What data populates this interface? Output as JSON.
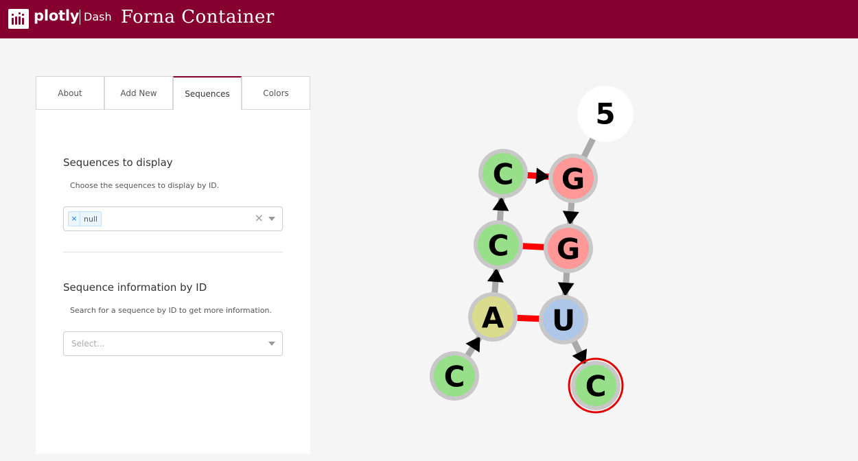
{
  "header": {
    "brand": "plotly",
    "brand_suffix": "Dash",
    "title": "Forna Container",
    "color": "#85002e"
  },
  "tabs": [
    {
      "label": "About",
      "active": false
    },
    {
      "label": "Add New",
      "active": false
    },
    {
      "label": "Sequences",
      "active": true
    },
    {
      "label": "Colors",
      "active": false
    }
  ],
  "display_section": {
    "title": "Sequences to display",
    "help": "Choose the sequences to display by ID.",
    "selected_values": [
      "null"
    ]
  },
  "info_section": {
    "title": "Sequence information by ID",
    "help": "Search for a sequence by ID to get more information.",
    "placeholder": "Select..."
  },
  "structure": {
    "end_label": "5",
    "nucleotides": [
      {
        "id": "n1",
        "base": "C",
        "color": "#98df8a"
      },
      {
        "id": "n2",
        "base": "A",
        "color": "#dbdb8d"
      },
      {
        "id": "n3",
        "base": "C",
        "color": "#98df8a"
      },
      {
        "id": "n4",
        "base": "C",
        "color": "#98df8a"
      },
      {
        "id": "n5",
        "base": "G",
        "color": "#ff9896"
      },
      {
        "id": "n6",
        "base": "G",
        "color": "#ff9896"
      },
      {
        "id": "n7",
        "base": "U",
        "color": "#aec7e8"
      },
      {
        "id": "n8",
        "base": "C",
        "color": "#98df8a",
        "highlighted": true
      }
    ],
    "pair_color": "#ff0000",
    "backbone_color": "#aaaaaa"
  }
}
